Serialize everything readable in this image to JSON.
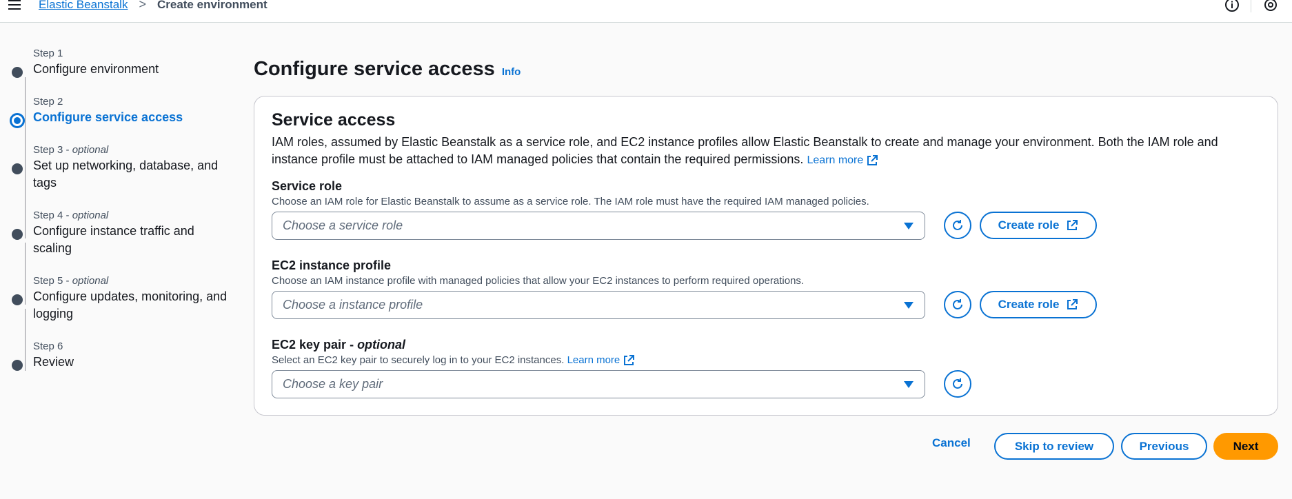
{
  "header": {
    "breadcrumb": [
      "Elastic Beanstalk",
      "Create environment"
    ],
    "icons": [
      "menu-icon",
      "info-circle-icon",
      "settings-icon"
    ]
  },
  "steps": [
    {
      "num": "Step 1",
      "optional": "",
      "title": "Configure environment",
      "state": "completed"
    },
    {
      "num": "Step 2",
      "optional": "",
      "title": "Configure service access",
      "state": "active"
    },
    {
      "num": "Step 3",
      "optional": "optional",
      "title": "Set up networking, database, and tags",
      "state": "pending"
    },
    {
      "num": "Step 4",
      "optional": "optional",
      "title": "Configure instance traffic and scaling",
      "state": "pending"
    },
    {
      "num": "Step 5",
      "optional": "optional",
      "title": "Configure updates, monitoring, and logging",
      "state": "pending"
    },
    {
      "num": "Step 6",
      "optional": "",
      "title": "Review",
      "state": "pending"
    }
  ],
  "page": {
    "title": "Configure service access",
    "info": "Info"
  },
  "card": {
    "title": "Service access",
    "description": "IAM roles, assumed by Elastic Beanstalk as a service role, and EC2 instance profiles allow Elastic Beanstalk to create and manage your environment. Both the IAM role and instance profile must be attached to IAM managed policies that contain the required permissions.",
    "learn_more": "Learn more"
  },
  "fields": {
    "service_role": {
      "label": "Service role",
      "description": "Choose an IAM role for Elastic Beanstalk to assume as a service role. The IAM role must have the required IAM managed policies.",
      "placeholder": "Choose a service role",
      "create_label": "Create role"
    },
    "instance_profile": {
      "label": "EC2 instance profile",
      "description": "Choose an IAM instance profile with managed policies that allow your EC2 instances to perform required operations.",
      "placeholder": "Choose a instance profile",
      "create_label": "Create role"
    },
    "key_pair": {
      "label": "EC2 key pair - ",
      "optional": "optional",
      "description": "Select an EC2 key pair to securely log in to your EC2 instances.",
      "learn_more": "Learn more",
      "placeholder": "Choose a key pair"
    }
  },
  "footer": {
    "cancel": "Cancel",
    "skip": "Skip to review",
    "previous": "Previous",
    "next": "Next"
  },
  "colors": {
    "accent": "#0972d3",
    "primary_button": "#ff9900",
    "text": "#16191f"
  }
}
